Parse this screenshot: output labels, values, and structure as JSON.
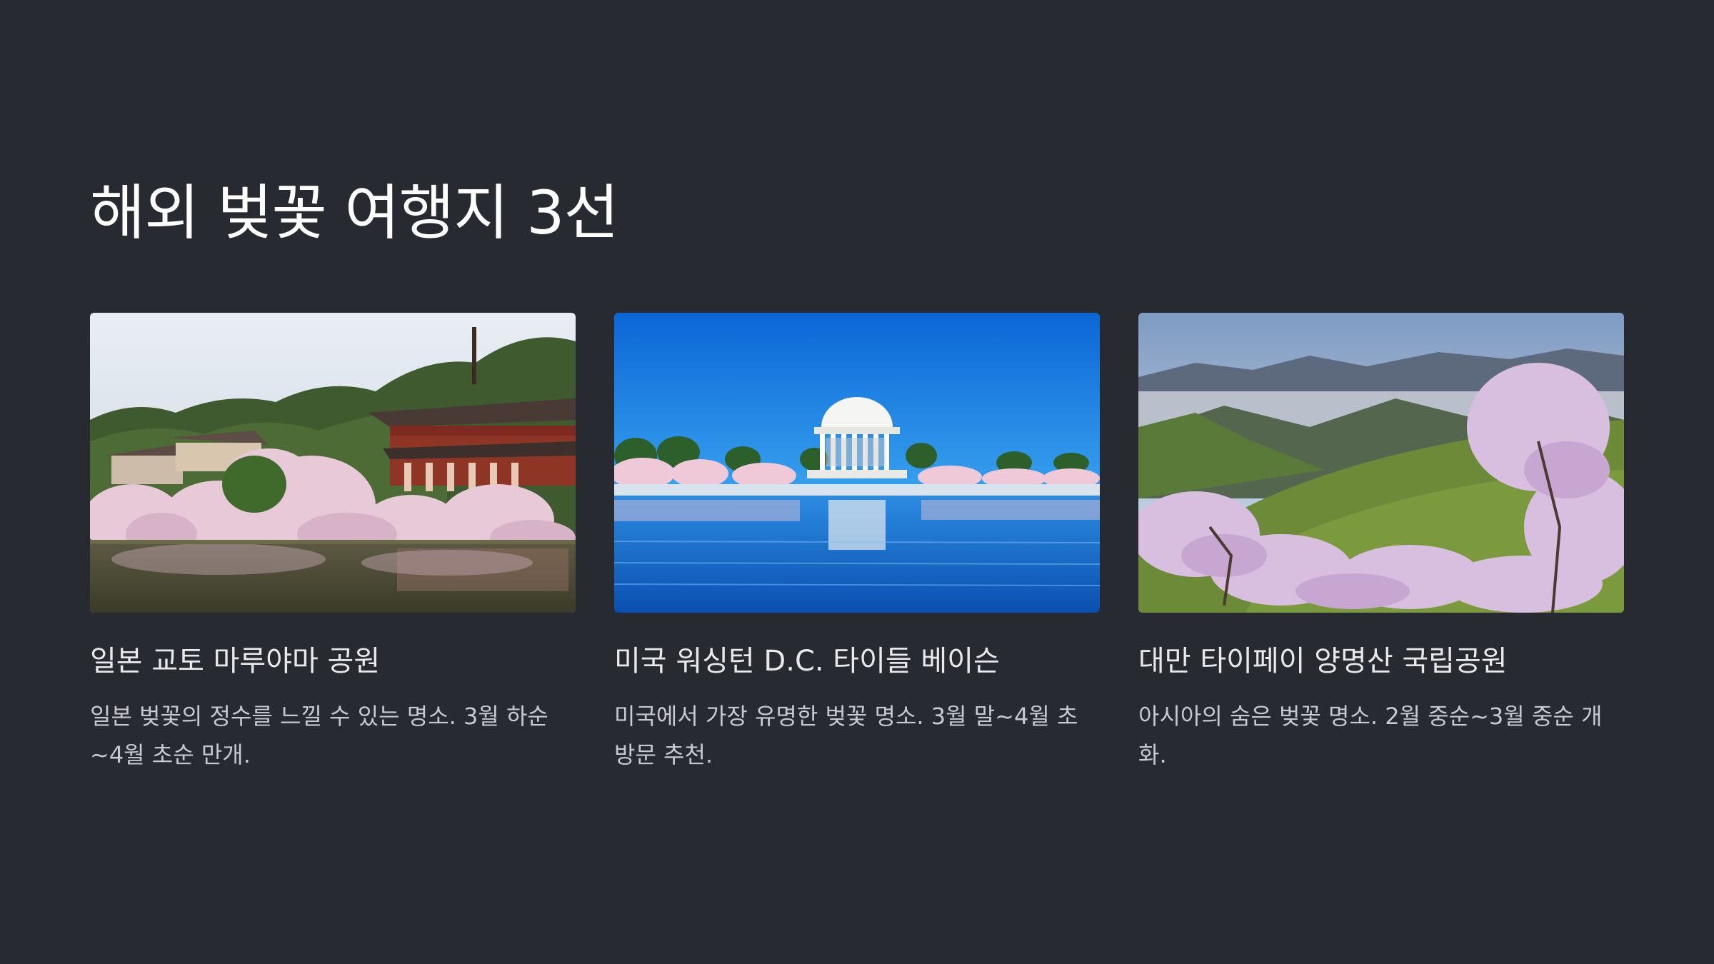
{
  "page": {
    "title": "해외 벚꽃 여행지 3선"
  },
  "cards": [
    {
      "image": "kyoto-temple-cherry-blossom-photo",
      "title": "일본 교토 마루야마 공원",
      "description": "일본 벚꽃의 정수를 느낄 수 있는 명소. 3월 하순~4월 초순 만개."
    },
    {
      "image": "washington-jefferson-memorial-tidal-basin-photo",
      "title": "미국 워싱턴 D.C. 타이들 베이슨",
      "description": "미국에서 가장 유명한 벚꽃 명소. 3월 말~4월 초 방문 추천."
    },
    {
      "image": "taipei-yangmingshan-mountains-blossom-photo",
      "title": "대만 타이페이 양명산 국립공원",
      "description": "아시아의 숨은 벚꽃 명소. 2월 중순~3월 중순 개화."
    }
  ],
  "colors": {
    "background": "#282a31",
    "title": "#ffffff",
    "card_title": "#e9e9ec",
    "card_desc": "#c7c9cf"
  }
}
